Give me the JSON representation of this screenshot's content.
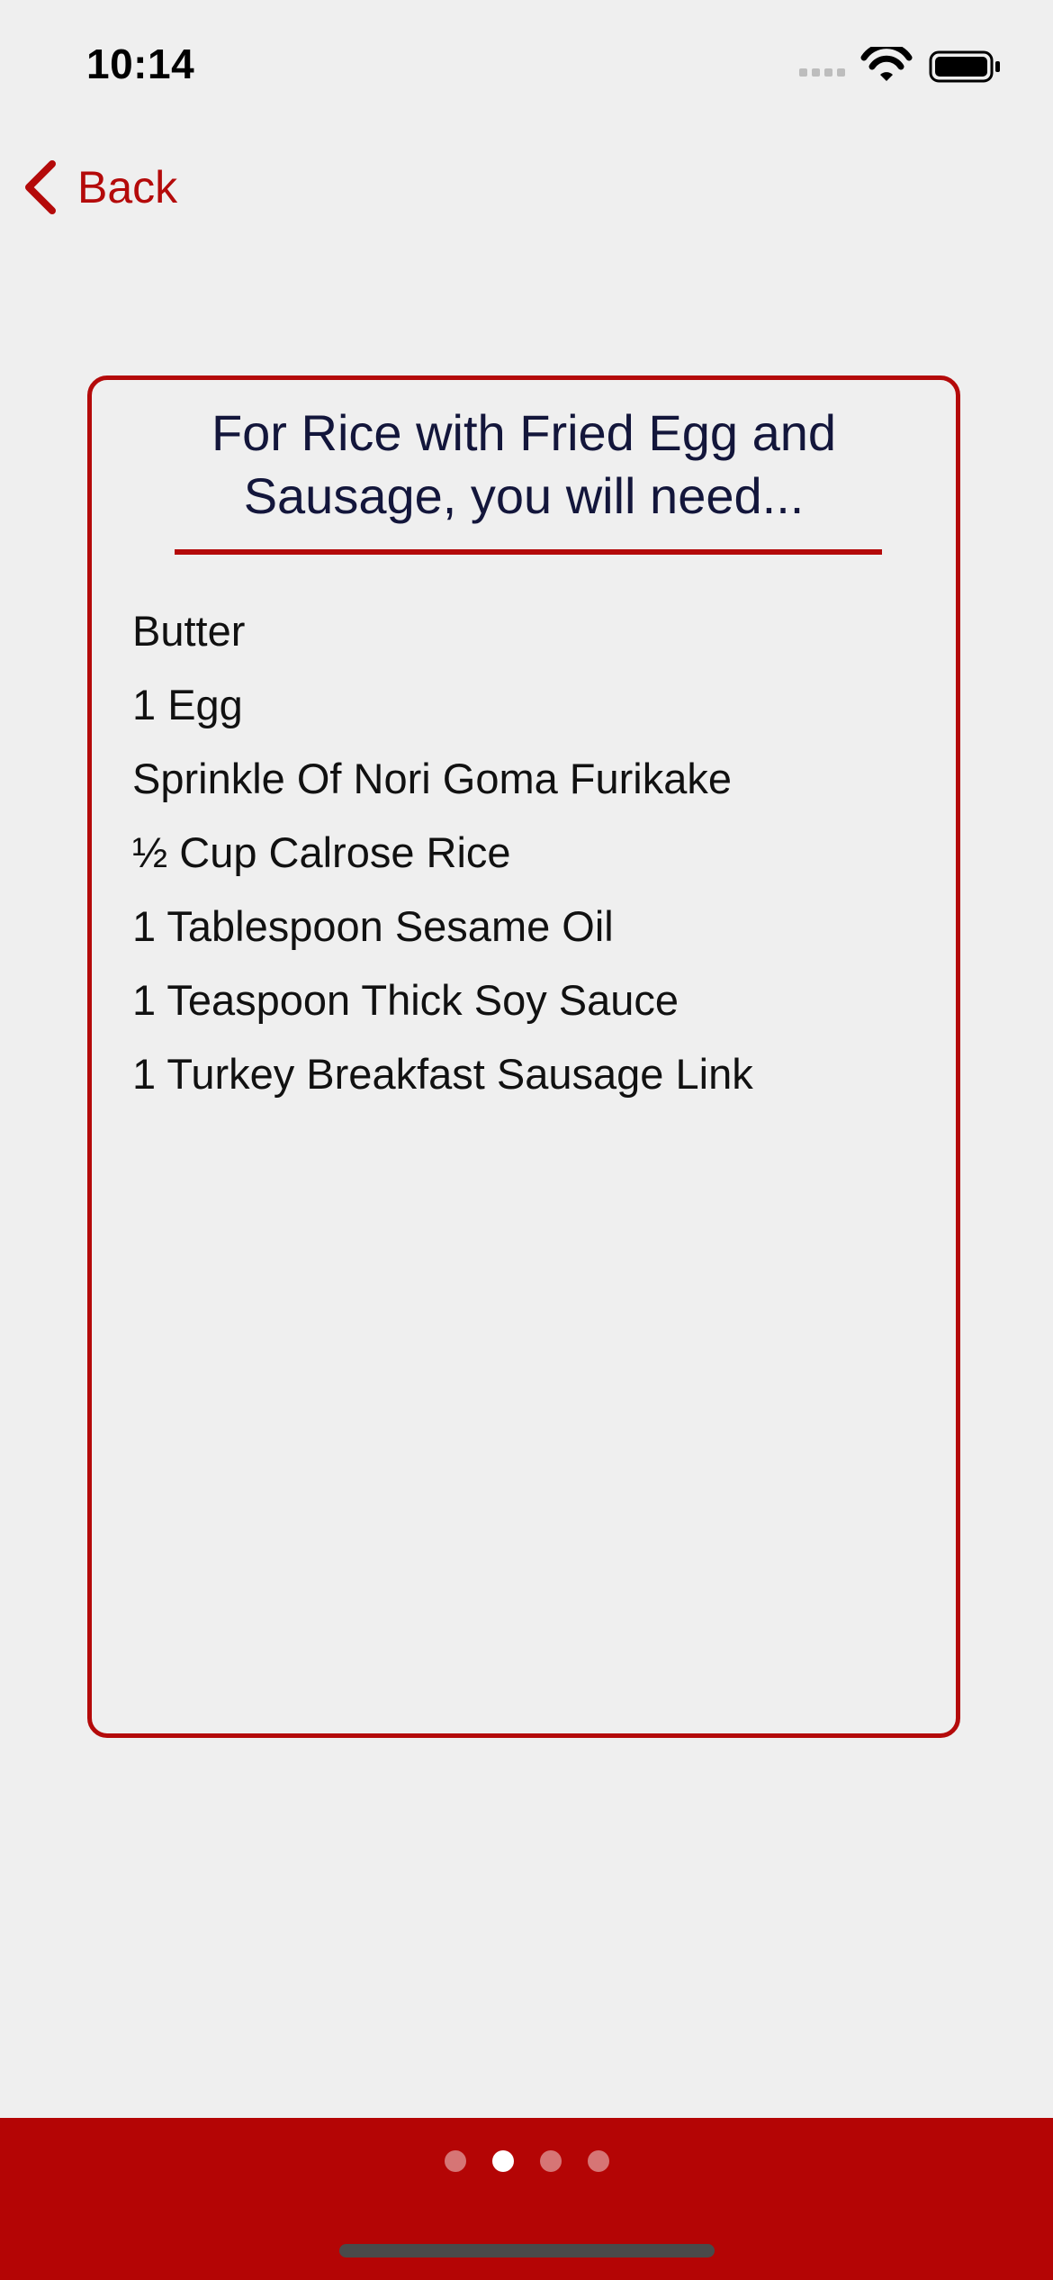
{
  "status_bar": {
    "time": "10:14",
    "icons": [
      "cellular-signal-icon",
      "wifi-icon",
      "battery-icon"
    ]
  },
  "nav": {
    "back_label": "Back",
    "back_icon": "chevron-left-icon"
  },
  "card": {
    "title": "For Rice with Fried Egg and\nSausage, you will need...",
    "ingredients": [
      "Butter",
      "1 Egg",
      "Sprinkle Of Nori Goma Furikake",
      "½ Cup Calrose Rice",
      "1 Tablespoon Sesame Oil",
      "1 Teaspoon Thick Soy Sauce",
      "1 Turkey Breakfast Sausage Link"
    ]
  },
  "pager": {
    "total_pages": 4,
    "current_page": 2
  },
  "colors": {
    "accent": "#b40a0a",
    "bottom_bar": "#b40505",
    "title_text": "#13163b",
    "background": "#efefef"
  }
}
